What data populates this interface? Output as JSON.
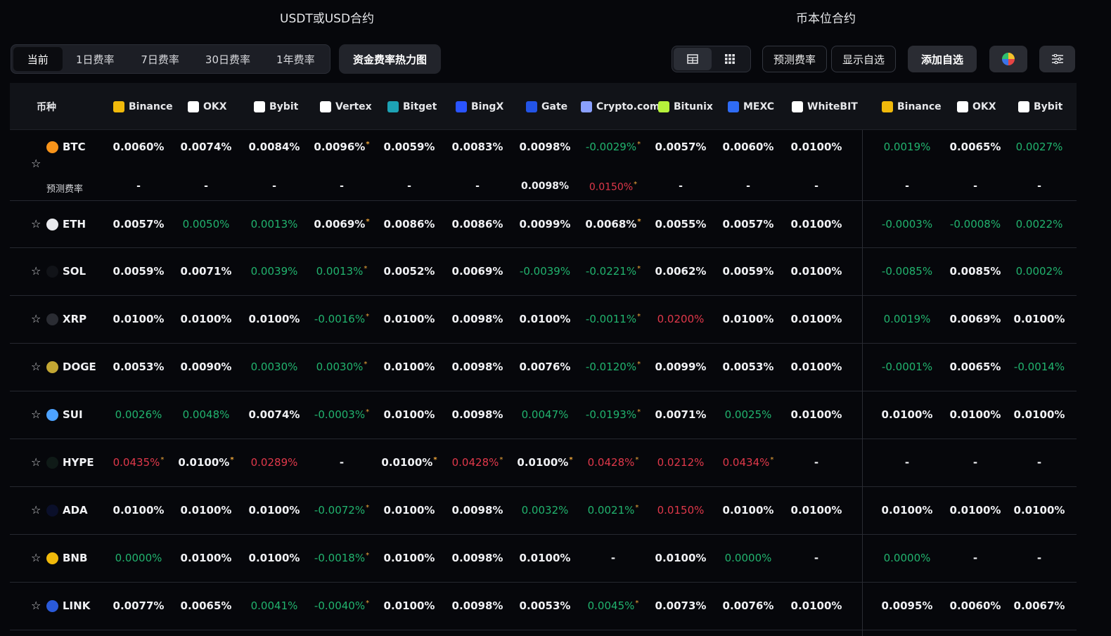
{
  "sections": {
    "usdt": "USDT或USD合约",
    "coin": "币本位合约"
  },
  "tabs": [
    {
      "label": "当前",
      "active": true
    },
    {
      "label": "1日费率",
      "active": false
    },
    {
      "label": "7日费率",
      "active": false
    },
    {
      "label": "30日费率",
      "active": false
    },
    {
      "label": "1年费率",
      "active": false
    }
  ],
  "heatmap_label": "资金费率热力图",
  "view_icons": [
    "table-view-icon",
    "grid-view-icon"
  ],
  "toolbar": {
    "predict_label": "预测费率",
    "show_fav_label": "显示自选",
    "add_fav_label": "添加自选"
  },
  "table": {
    "coin_header": "币种",
    "predict_label": "预测费率",
    "exchanges": [
      {
        "name": "Binance",
        "color": "#f0b90b"
      },
      {
        "name": "OKX",
        "color": "#ffffff"
      },
      {
        "name": "Bybit",
        "color": "#ffffff"
      },
      {
        "name": "Vertex",
        "color": "#ffffff"
      },
      {
        "name": "Bitget",
        "color": "#1da2b4"
      },
      {
        "name": "BingX",
        "color": "#2a54ff"
      },
      {
        "name": "Gate",
        "color": "#2354e6"
      },
      {
        "name": "Crypto.com",
        "color": "#8aa0ff"
      },
      {
        "name": "Bitunix",
        "color": "#b6f23b"
      },
      {
        "name": "MEXC",
        "color": "#2f6cf5"
      },
      {
        "name": "WhiteBIT",
        "color": "#ffffff"
      },
      {
        "name": "Binance",
        "color": "#f0b90b"
      },
      {
        "name": "OKX",
        "color": "#ffffff"
      },
      {
        "name": "Bybit",
        "color": "#ffffff"
      }
    ],
    "rows": [
      {
        "coin": "BTC",
        "icon_color": "#f7931a",
        "values": [
          [
            "0.0060%",
            "p",
            false
          ],
          [
            "0.0074%",
            "p",
            false
          ],
          [
            "0.0084%",
            "p",
            false
          ],
          [
            "0.0096%",
            "p",
            true
          ],
          [
            "0.0059%",
            "p",
            false
          ],
          [
            "0.0083%",
            "p",
            false
          ],
          [
            "0.0098%",
            "p",
            false
          ],
          [
            "-0.0029%",
            "g",
            true
          ],
          [
            "0.0057%",
            "p",
            false
          ],
          [
            "0.0060%",
            "p",
            false
          ],
          [
            "0.0100%",
            "p",
            false
          ],
          [
            "0.0019%",
            "g",
            false
          ],
          [
            "0.0065%",
            "p",
            false
          ],
          [
            "0.0027%",
            "g",
            false
          ]
        ],
        "predicted": [
          [
            "-",
            "p",
            false
          ],
          [
            "-",
            "p",
            false
          ],
          [
            "-",
            "p",
            false
          ],
          [
            "-",
            "p",
            false
          ],
          [
            "-",
            "p",
            false
          ],
          [
            "-",
            "p",
            false
          ],
          [
            "0.0098%",
            "p",
            false
          ],
          [
            "0.0150%",
            "r",
            true
          ],
          [
            "-",
            "p",
            false
          ],
          [
            "-",
            "p",
            false
          ],
          [
            "-",
            "p",
            false
          ],
          [
            "-",
            "p",
            false
          ],
          [
            "-",
            "p",
            false
          ],
          [
            "-",
            "p",
            false
          ]
        ]
      },
      {
        "coin": "ETH",
        "icon_color": "#e9eaee",
        "values": [
          [
            "0.0057%",
            "p",
            false
          ],
          [
            "0.0050%",
            "g",
            false
          ],
          [
            "0.0013%",
            "g",
            false
          ],
          [
            "0.0069%",
            "p",
            true
          ],
          [
            "0.0086%",
            "p",
            false
          ],
          [
            "0.0086%",
            "p",
            false
          ],
          [
            "0.0099%",
            "p",
            false
          ],
          [
            "0.0068%",
            "p",
            true
          ],
          [
            "0.0055%",
            "p",
            false
          ],
          [
            "0.0057%",
            "p",
            false
          ],
          [
            "0.0100%",
            "p",
            false
          ],
          [
            "-0.0003%",
            "g",
            false
          ],
          [
            "-0.0008%",
            "g",
            false
          ],
          [
            "0.0022%",
            "g",
            false
          ]
        ]
      },
      {
        "coin": "SOL",
        "icon_color": "#111318",
        "values": [
          [
            "0.0059%",
            "p",
            false
          ],
          [
            "0.0071%",
            "p",
            false
          ],
          [
            "0.0039%",
            "g",
            false
          ],
          [
            "0.0013%",
            "g",
            true
          ],
          [
            "0.0052%",
            "p",
            false
          ],
          [
            "0.0069%",
            "p",
            false
          ],
          [
            "-0.0039%",
            "g",
            false
          ],
          [
            "-0.0221%",
            "g",
            true
          ],
          [
            "0.0062%",
            "p",
            false
          ],
          [
            "0.0059%",
            "p",
            false
          ],
          [
            "0.0100%",
            "p",
            false
          ],
          [
            "-0.0085%",
            "g",
            false
          ],
          [
            "0.0085%",
            "p",
            false
          ],
          [
            "0.0002%",
            "g",
            false
          ]
        ]
      },
      {
        "coin": "XRP",
        "icon_color": "#2a2c33",
        "values": [
          [
            "0.0100%",
            "p",
            false
          ],
          [
            "0.0100%",
            "p",
            false
          ],
          [
            "0.0100%",
            "p",
            false
          ],
          [
            "-0.0016%",
            "g",
            true
          ],
          [
            "0.0100%",
            "p",
            false
          ],
          [
            "0.0098%",
            "p",
            false
          ],
          [
            "0.0100%",
            "p",
            false
          ],
          [
            "-0.0011%",
            "g",
            true
          ],
          [
            "0.0200%",
            "r",
            false
          ],
          [
            "0.0100%",
            "p",
            false
          ],
          [
            "0.0100%",
            "p",
            false
          ],
          [
            "0.0019%",
            "g",
            false
          ],
          [
            "0.0069%",
            "p",
            false
          ],
          [
            "0.0100%",
            "p",
            false
          ]
        ]
      },
      {
        "coin": "DOGE",
        "icon_color": "#c2a633",
        "values": [
          [
            "0.0053%",
            "p",
            false
          ],
          [
            "0.0090%",
            "p",
            false
          ],
          [
            "0.0030%",
            "g",
            false
          ],
          [
            "0.0030%",
            "g",
            true
          ],
          [
            "0.0100%",
            "p",
            false
          ],
          [
            "0.0098%",
            "p",
            false
          ],
          [
            "0.0076%",
            "p",
            false
          ],
          [
            "-0.0120%",
            "g",
            true
          ],
          [
            "0.0099%",
            "p",
            false
          ],
          [
            "0.0053%",
            "p",
            false
          ],
          [
            "0.0100%",
            "p",
            false
          ],
          [
            "-0.0001%",
            "g",
            false
          ],
          [
            "0.0065%",
            "p",
            false
          ],
          [
            "-0.0014%",
            "g",
            false
          ]
        ]
      },
      {
        "coin": "SUI",
        "icon_color": "#4da2ff",
        "values": [
          [
            "0.0026%",
            "g",
            false
          ],
          [
            "0.0048%",
            "g",
            false
          ],
          [
            "0.0074%",
            "p",
            false
          ],
          [
            "-0.0003%",
            "g",
            true
          ],
          [
            "0.0100%",
            "p",
            false
          ],
          [
            "0.0098%",
            "p",
            false
          ],
          [
            "0.0047%",
            "g",
            false
          ],
          [
            "-0.0193%",
            "g",
            true
          ],
          [
            "0.0071%",
            "p",
            false
          ],
          [
            "0.0025%",
            "g",
            false
          ],
          [
            "0.0100%",
            "p",
            false
          ],
          [
            "0.0100%",
            "p",
            false
          ],
          [
            "0.0100%",
            "p",
            false
          ],
          [
            "0.0100%",
            "p",
            false
          ]
        ]
      },
      {
        "coin": "HYPE",
        "icon_color": "#0f1a17",
        "values": [
          [
            "0.0435%",
            "r",
            true
          ],
          [
            "0.0100%",
            "p",
            true
          ],
          [
            "0.0289%",
            "r",
            false
          ],
          [
            "-",
            "p",
            false
          ],
          [
            "0.0100%",
            "p",
            true
          ],
          [
            "0.0428%",
            "r",
            true
          ],
          [
            "0.0100%",
            "p",
            true
          ],
          [
            "0.0428%",
            "r",
            true
          ],
          [
            "0.0212%",
            "r",
            false
          ],
          [
            "0.0434%",
            "r",
            true
          ],
          [
            "-",
            "p",
            false
          ],
          [
            "-",
            "p",
            false
          ],
          [
            "-",
            "p",
            false
          ],
          [
            "-",
            "p",
            false
          ]
        ]
      },
      {
        "coin": "ADA",
        "icon_color": "#0a0f2a",
        "values": [
          [
            "0.0100%",
            "p",
            false
          ],
          [
            "0.0100%",
            "p",
            false
          ],
          [
            "0.0100%",
            "p",
            false
          ],
          [
            "-0.0072%",
            "g",
            true
          ],
          [
            "0.0100%",
            "p",
            false
          ],
          [
            "0.0098%",
            "p",
            false
          ],
          [
            "0.0032%",
            "g",
            false
          ],
          [
            "0.0021%",
            "g",
            true
          ],
          [
            "0.0150%",
            "r",
            false
          ],
          [
            "0.0100%",
            "p",
            false
          ],
          [
            "0.0100%",
            "p",
            false
          ],
          [
            "0.0100%",
            "p",
            false
          ],
          [
            "0.0100%",
            "p",
            false
          ],
          [
            "0.0100%",
            "p",
            false
          ]
        ]
      },
      {
        "coin": "BNB",
        "icon_color": "#f0b90b",
        "values": [
          [
            "0.0000%",
            "g",
            false
          ],
          [
            "0.0100%",
            "p",
            false
          ],
          [
            "0.0100%",
            "p",
            false
          ],
          [
            "-0.0018%",
            "g",
            true
          ],
          [
            "0.0100%",
            "p",
            false
          ],
          [
            "0.0098%",
            "p",
            false
          ],
          [
            "0.0100%",
            "p",
            false
          ],
          [
            "-",
            "p",
            false
          ],
          [
            "0.0100%",
            "p",
            false
          ],
          [
            "0.0000%",
            "g",
            false
          ],
          [
            "-",
            "p",
            false
          ],
          [
            "0.0000%",
            "g",
            false
          ],
          [
            "-",
            "p",
            false
          ],
          [
            "-",
            "p",
            false
          ]
        ]
      },
      {
        "coin": "LINK",
        "icon_color": "#2a5ada",
        "values": [
          [
            "0.0077%",
            "p",
            false
          ],
          [
            "0.0065%",
            "p",
            false
          ],
          [
            "0.0041%",
            "g",
            false
          ],
          [
            "-0.0040%",
            "g",
            true
          ],
          [
            "0.0100%",
            "p",
            false
          ],
          [
            "0.0098%",
            "p",
            false
          ],
          [
            "0.0053%",
            "p",
            false
          ],
          [
            "0.0045%",
            "g",
            true
          ],
          [
            "0.0073%",
            "p",
            false
          ],
          [
            "0.0076%",
            "p",
            false
          ],
          [
            "0.0100%",
            "p",
            false
          ],
          [
            "0.0095%",
            "p",
            false
          ],
          [
            "0.0060%",
            "p",
            false
          ],
          [
            "0.0067%",
            "p",
            false
          ]
        ]
      }
    ]
  }
}
